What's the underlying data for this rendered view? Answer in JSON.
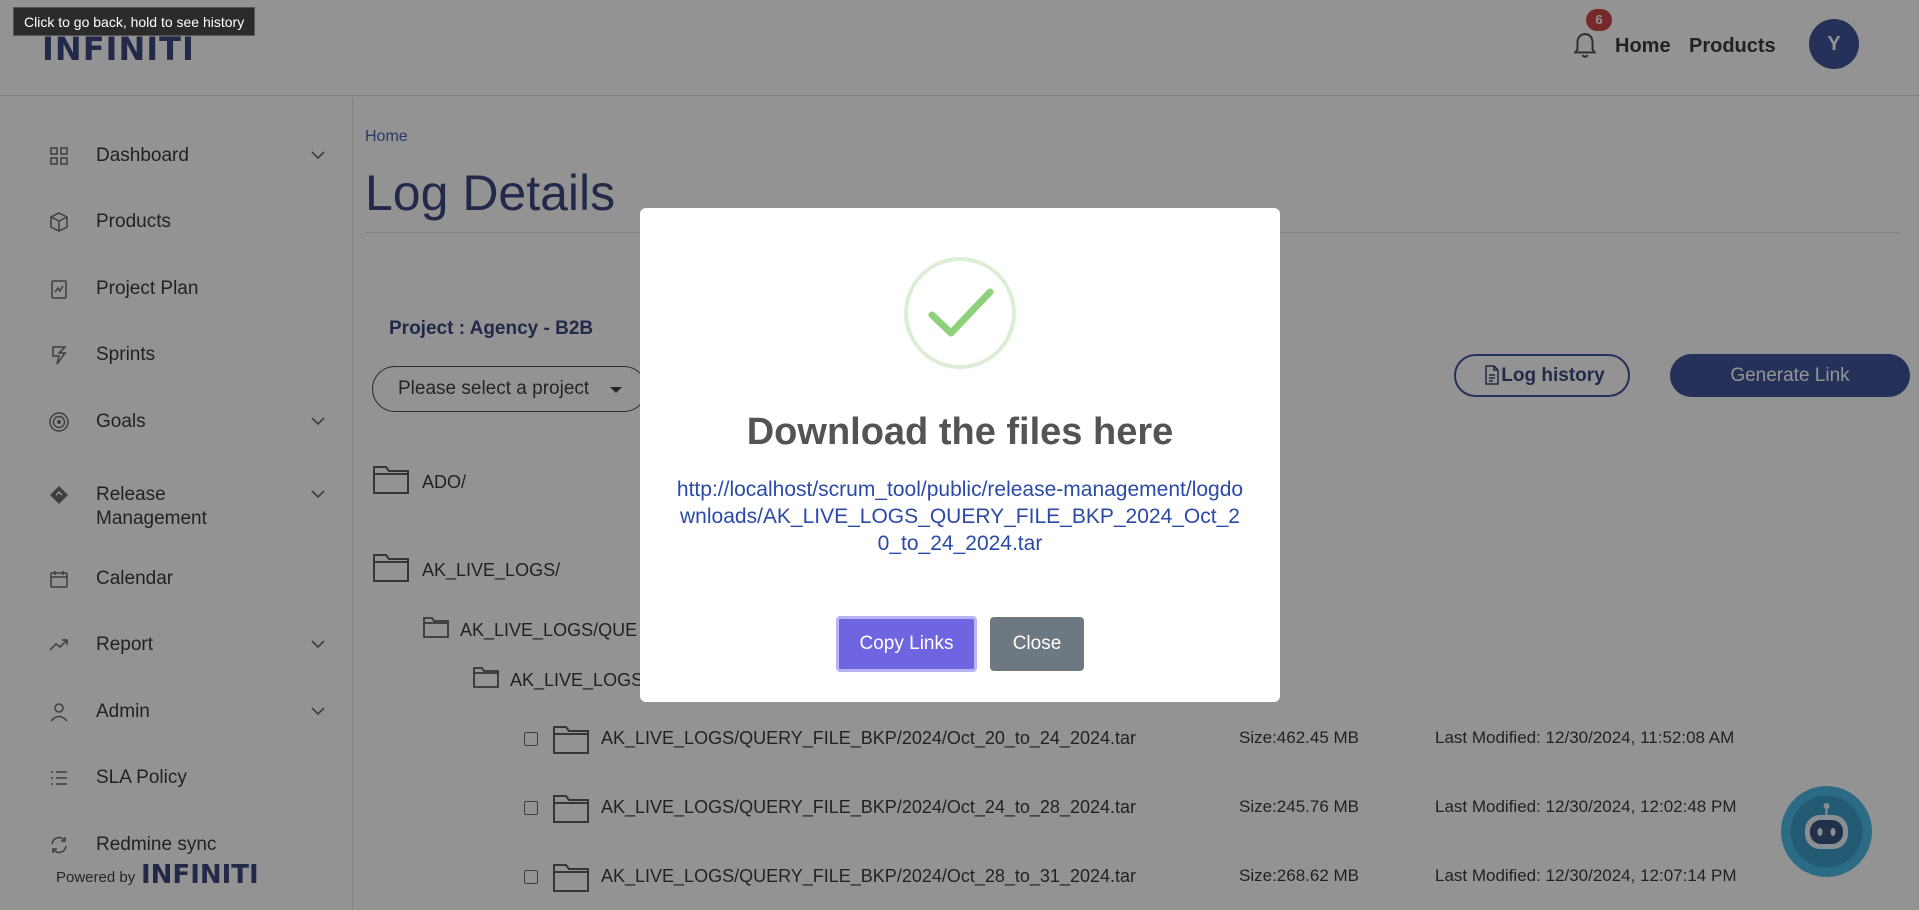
{
  "header": {
    "logo_text": "INFINITI",
    "tooltip": "Click to go back, hold to see history",
    "notification_count": "6",
    "nav": [
      {
        "label": "Home"
      },
      {
        "label": "Products"
      }
    ],
    "avatar_initial": "Y"
  },
  "sidebar": {
    "items": [
      {
        "label": "Dashboard",
        "icon": "grid-icon",
        "has_submenu": true
      },
      {
        "label": "Products",
        "icon": "box-icon",
        "has_submenu": false
      },
      {
        "label": "Project Plan",
        "icon": "plan-icon",
        "has_submenu": false
      },
      {
        "label": "Sprints",
        "icon": "sprint-icon",
        "has_submenu": false
      },
      {
        "label": "Goals",
        "icon": "target-icon",
        "has_submenu": true
      },
      {
        "label": "Release Management",
        "icon": "release-icon",
        "has_submenu": true
      },
      {
        "label": "Calendar",
        "icon": "calendar-icon",
        "has_submenu": false
      },
      {
        "label": "Report",
        "icon": "trend-icon",
        "has_submenu": true
      },
      {
        "label": "Admin",
        "icon": "user-icon",
        "has_submenu": true
      },
      {
        "label": "SLA Policy",
        "icon": "list-icon",
        "has_submenu": false
      },
      {
        "label": "Redmine sync",
        "icon": "sync-icon",
        "has_submenu": false
      }
    ],
    "powered_by": "Powered by",
    "powered_logo": "INFINITI"
  },
  "main": {
    "breadcrumb": "Home",
    "title": "Log Details",
    "project_label": "Project : Agency - B2B",
    "select_placeholder": "Please select a project",
    "log_history_label": "Log history",
    "generate_link_label": "Generate Link",
    "folders": [
      {
        "label": "ADO/"
      },
      {
        "label": "AK_LIVE_LOGS/"
      },
      {
        "label": "AK_LIVE_LOGS/QUE"
      },
      {
        "label": "AK_LIVE_LOGS"
      }
    ],
    "files": [
      {
        "name": "AK_LIVE_LOGS/QUERY_FILE_BKP/2024/Oct_20_to_24_2024.tar",
        "size": "Size:462.45 MB",
        "modified": "Last Modified: 12/30/2024, 11:52:08 AM"
      },
      {
        "name": "AK_LIVE_LOGS/QUERY_FILE_BKP/2024/Oct_24_to_28_2024.tar",
        "size": "Size:245.76 MB",
        "modified": "Last Modified: 12/30/2024, 12:02:48 PM"
      },
      {
        "name": "AK_LIVE_LOGS/QUERY_FILE_BKP/2024/Oct_28_to_31_2024.tar",
        "size": "Size:268.62 MB",
        "modified": "Last Modified: 12/30/2024, 12:07:14 PM"
      }
    ]
  },
  "modal": {
    "title": "Download the files here",
    "link": "http://localhost/scrum_tool/public/release-management/logdownloads/AK_LIVE_LOGS_QUERY_FILE_BKP_2024_Oct_20_to_24_2024.tar",
    "copy_label": "Copy Links",
    "close_label": "Close"
  },
  "colors": {
    "brand": "#1d2b6b",
    "accent": "#243a8c",
    "copy_button": "#7065e0",
    "close_button": "#6e7881",
    "success": "#8fd07a"
  }
}
